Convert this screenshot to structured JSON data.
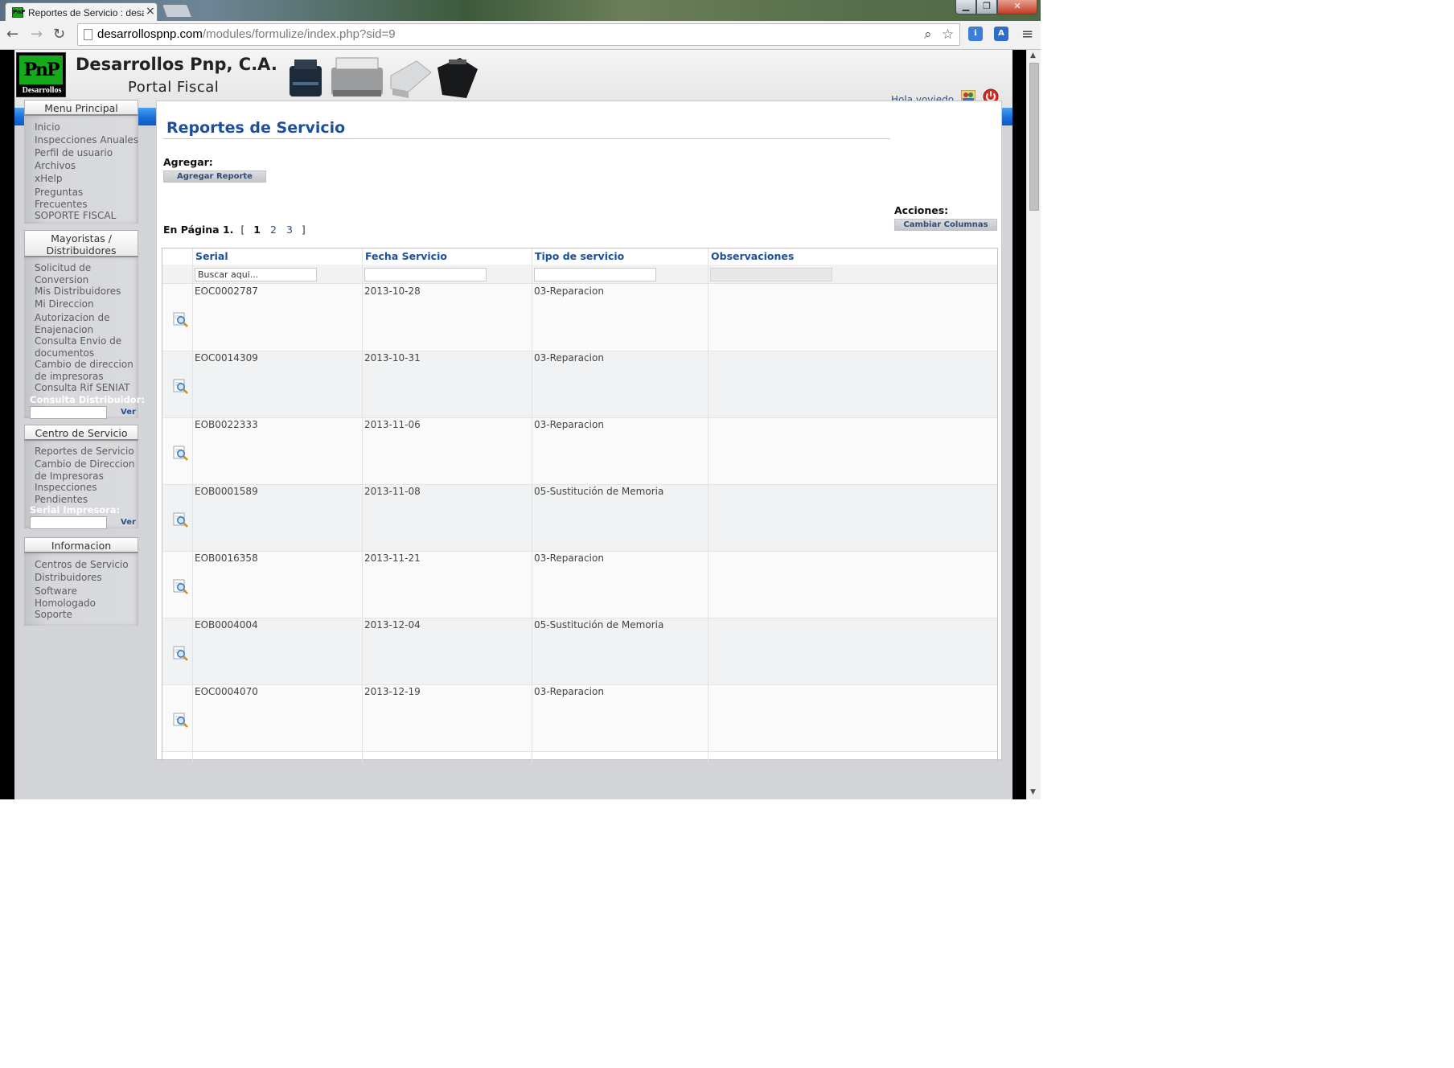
{
  "browser": {
    "tab_title": "Reportes de Servicio : desa",
    "tab_favicon_text": "PnP",
    "tab_close": "×",
    "url_host": "desarrollospnp.com",
    "url_path": "/modules/formulize/index.php?sid=9",
    "icons": [
      "back-icon",
      "forward-icon",
      "reload-icon",
      "page-icon",
      "search-icon",
      "star-icon",
      "extension-icon",
      "translate-icon",
      "menu-icon",
      "minimize-icon",
      "maximize-icon",
      "close-icon"
    ]
  },
  "header": {
    "logo_top": "PnP",
    "logo_bottom": "Desarrollos",
    "company": "Desarrollos Pnp, C.A.",
    "portal": "Portal Fiscal",
    "greeting": "Hola yoviedo"
  },
  "sidebar": {
    "menu_principal": {
      "title": "Menu Principal",
      "items": [
        "Inicio",
        "Inspecciones Anuales",
        "Perfil de usuario",
        "Archivos",
        "xHelp",
        "Preguntas\nFrecuentes",
        "SOPORTE FISCAL"
      ]
    },
    "mayoristas": {
      "title": "Mayoristas /\nDistribuidores",
      "items": [
        "Solicitud de\nConversion",
        "Mis Distribuidores",
        "Mi Direccion",
        "Autorizacion de\nEnajenacion",
        "Consulta Envio de\ndocumentos",
        "Cambio de direccion\nde impresoras",
        "Consulta Rif SENIAT"
      ],
      "search_label": "Consulta Distribuidor:",
      "search_button": "Ver"
    },
    "centro": {
      "title": "Centro de Servicio",
      "items": [
        "Reportes de Servicio",
        "Cambio de Direccion\nde Impresoras",
        "Inspecciones\nPendientes"
      ],
      "search_label": "Serial Impresora:",
      "search_button": "Ver"
    },
    "informacion": {
      "title": "Informacion",
      "items": [
        "Centros de Servicio",
        "Distribuidores",
        "Software\nHomologado",
        "Soporte"
      ]
    }
  },
  "main": {
    "title": "Reportes de Servicio",
    "add_label": "Agregar:",
    "add_button": "Agregar Reporte",
    "actions_label": "Acciones:",
    "columns_button": "Cambiar Columnas",
    "pager": {
      "label": "En Página 1.",
      "open": "[",
      "current": "1",
      "pages": [
        "2",
        "3"
      ],
      "close": "]"
    },
    "table": {
      "columns": [
        "Serial",
        "Fecha Servicio",
        "Tipo de servicio",
        "Observaciones"
      ],
      "search_placeholder": "Buscar aqui...",
      "rows": [
        {
          "serial": "EOC0002787",
          "fecha": "2013-10-28",
          "tipo": "03-Reparacion",
          "obs": ""
        },
        {
          "serial": "EOC0014309",
          "fecha": "2013-10-31",
          "tipo": "03-Reparacion",
          "obs": ""
        },
        {
          "serial": "EOB0022333",
          "fecha": "2013-11-06",
          "tipo": "03-Reparacion",
          "obs": ""
        },
        {
          "serial": "EOB0001589",
          "fecha": "2013-11-08",
          "tipo": "05-Sustitución de Memoria",
          "obs": ""
        },
        {
          "serial": "EOB0016358",
          "fecha": "2013-11-21",
          "tipo": "03-Reparacion",
          "obs": ""
        },
        {
          "serial": "EOB0004004",
          "fecha": "2013-12-04",
          "tipo": "05-Sustitución de Memoria",
          "obs": ""
        },
        {
          "serial": "EOC0004070",
          "fecha": "2013-12-19",
          "tipo": "03-Reparacion",
          "obs": ""
        }
      ]
    }
  },
  "colors": {
    "accent_blue": "#1d4f9e",
    "header_bar": "#1a6fd6",
    "logo_green": "#14a81a",
    "sidebar_gray": "#d3d4d8"
  }
}
